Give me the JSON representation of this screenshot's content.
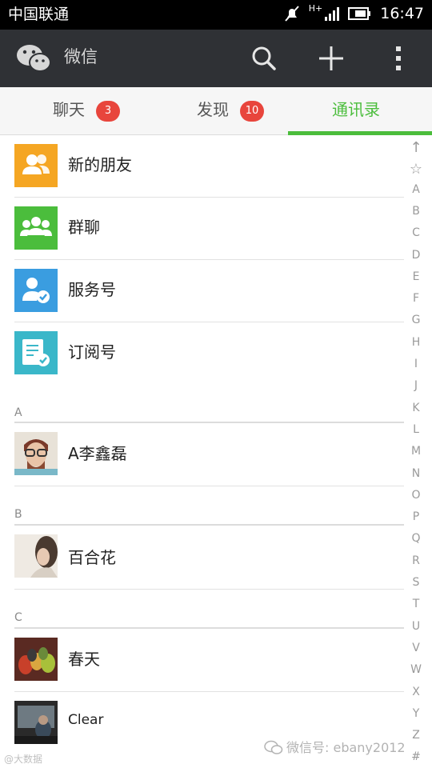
{
  "status_bar": {
    "carrier": "中国联通",
    "network": "H+",
    "time": "16:47"
  },
  "app_bar": {
    "title": "微信"
  },
  "tabs": [
    {
      "label": "聊天",
      "badge": "3"
    },
    {
      "label": "发现",
      "badge": "10"
    },
    {
      "label": "通讯录",
      "badge": ""
    }
  ],
  "fixed_items": [
    {
      "label": "新的朋友",
      "icon": "new-friends-icon",
      "color": "#f5a623"
    },
    {
      "label": "群聊",
      "icon": "group-chat-icon",
      "color": "#4bbd3c"
    },
    {
      "label": "服务号",
      "icon": "service-account-icon",
      "color": "#3a9de0"
    },
    {
      "label": "订阅号",
      "icon": "subscription-icon",
      "color": "#3ab7c9"
    }
  ],
  "sections": [
    {
      "letter": "A",
      "contacts": [
        "A李鑫磊"
      ]
    },
    {
      "letter": "B",
      "contacts": [
        "百合花"
      ]
    },
    {
      "letter": "C",
      "contacts": [
        "春天",
        "Clear"
      ]
    }
  ],
  "index_bar": [
    "↑",
    "☆",
    "A",
    "B",
    "C",
    "D",
    "E",
    "F",
    "G",
    "H",
    "I",
    "J",
    "K",
    "L",
    "M",
    "N",
    "O",
    "P",
    "Q",
    "R",
    "S",
    "T",
    "U",
    "V",
    "W",
    "X",
    "Y",
    "Z",
    "#"
  ],
  "watermark": "微信号: ebany2012",
  "watermark_left": "@大数据"
}
